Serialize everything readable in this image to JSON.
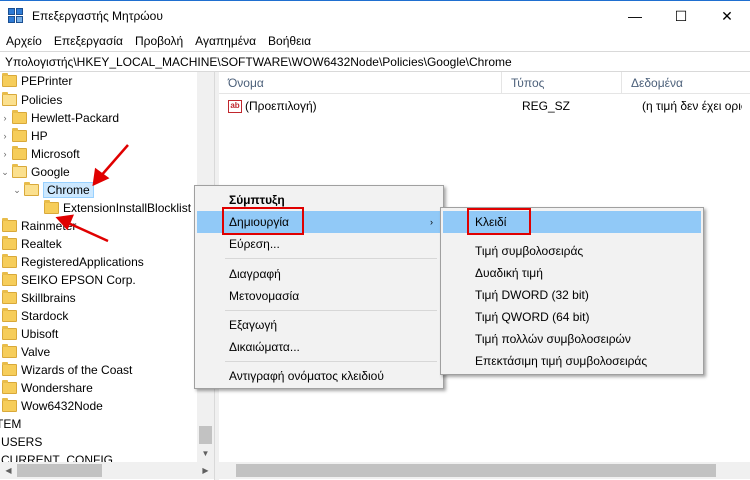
{
  "window": {
    "title": "Επεξεργαστής Μητρώου",
    "minimize": "—",
    "maximize": "☐",
    "close": "✕"
  },
  "menubar": [
    "Αρχείο",
    "Επεξεργασία",
    "Προβολή",
    "Αγαπημένα",
    "Βοήθεια"
  ],
  "address": "Υπολογιστής\\HKEY_LOCAL_MACHINE\\SOFTWARE\\WOW6432Node\\Policies\\Google\\Chrome",
  "tree": [
    {
      "label": "PEPrinter",
      "indent": 0,
      "expander": ""
    },
    {
      "label": "Policies",
      "indent": 0,
      "expander": "⌄"
    },
    {
      "label": "Hewlett-Packard",
      "indent": 1,
      "expander": "›"
    },
    {
      "label": "HP",
      "indent": 1,
      "expander": "›"
    },
    {
      "label": "Microsoft",
      "indent": 1,
      "expander": "›"
    },
    {
      "label": "Google",
      "indent": 1,
      "expander": "⌄"
    },
    {
      "label": "Chrome",
      "indent": 2,
      "expander": "⌄",
      "selected": true
    },
    {
      "label": "ExtensionInstallBlocklist",
      "indent": 3,
      "expander": ""
    },
    {
      "label": "Rainmeter",
      "indent": 0,
      "expander": ""
    },
    {
      "label": "Realtek",
      "indent": 0,
      "expander": ""
    },
    {
      "label": "RegisteredApplications",
      "indent": 0,
      "expander": ""
    },
    {
      "label": "SEIKO EPSON Corp.",
      "indent": 0,
      "expander": ""
    },
    {
      "label": "Skillbrains",
      "indent": 0,
      "expander": ""
    },
    {
      "label": "Stardock",
      "indent": 0,
      "expander": ""
    },
    {
      "label": "Ubisoft",
      "indent": 0,
      "expander": ""
    },
    {
      "label": "Valve",
      "indent": 0,
      "expander": ""
    },
    {
      "label": "Wizards of the Coast",
      "indent": 0,
      "expander": ""
    },
    {
      "label": "Wondershare",
      "indent": 0,
      "expander": ""
    },
    {
      "label": "Wow6432Node",
      "indent": 0,
      "expander": ""
    },
    {
      "label": "TEM",
      "indent": -1,
      "expander": ""
    },
    {
      "label": "USERS",
      "indent": -1,
      "expander": ""
    },
    {
      "label": "CURRENT_CONFIG",
      "indent": -1,
      "expander": ""
    }
  ],
  "columns": [
    "Όνομα",
    "Τύπος",
    "Δεδομένα"
  ],
  "values": [
    {
      "name": "(Προεπιλογή)",
      "type": "REG_SZ",
      "data": "(η τιμή δεν έχει οριστεί)"
    }
  ],
  "context_menu": {
    "items": [
      "Σύμπτυξη",
      "Δημιουργία",
      "Εύρεση...",
      "Διαγραφή",
      "Μετονομασία",
      "Εξαγωγή",
      "Δικαιώματα...",
      "Αντιγραφή ονόματος κλειδιού"
    ]
  },
  "submenu": {
    "items": [
      "Κλειδί",
      "Τιμή συμβολοσειράς",
      "Δυαδική τιμή",
      "Τιμή DWORD (32 bit)",
      "Τιμή QWORD (64 bit)",
      "Τιμή πολλών συμβολοσειρών",
      "Επεκτάσιμη τιμή συμβολοσειράς"
    ]
  },
  "colors": {
    "highlight": "#91c9f7",
    "annotation": "#e00000",
    "selection": "#cce8ff"
  }
}
